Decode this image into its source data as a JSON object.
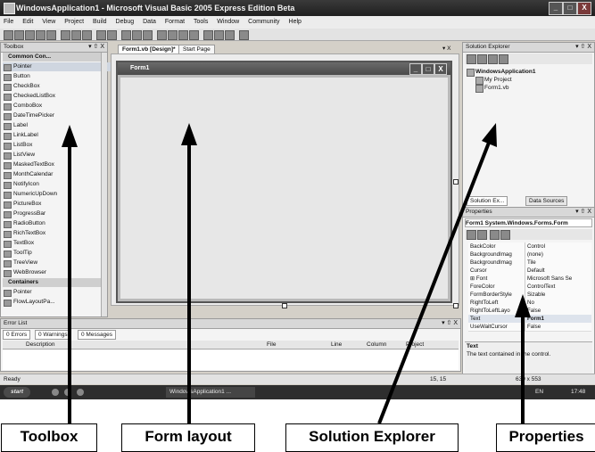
{
  "window": {
    "title": "WindowsApplication1 - Microsoft Visual Basic 2005 Express Edition Beta",
    "minimize_glyph": "_",
    "maximize_glyph": "□",
    "close_glyph": "X"
  },
  "menu": [
    "File",
    "Edit",
    "View",
    "Project",
    "Build",
    "Debug",
    "Data",
    "Format",
    "Tools",
    "Window",
    "Community",
    "Help"
  ],
  "toolbox": {
    "title": "Toolbox",
    "pin": "▾ ⇧ X",
    "sections": {
      "common": "Common Con...",
      "containers": "Containers"
    },
    "items": [
      "Pointer",
      "Button",
      "CheckBox",
      "CheckedListBox",
      "ComboBox",
      "DateTimePicker",
      "Label",
      "LinkLabel",
      "ListBox",
      "ListView",
      "MaskedTextBox",
      "MonthCalendar",
      "NotifyIcon",
      "NumericUpDown",
      "PictureBox",
      "ProgressBar",
      "RadioButton",
      "RichTextBox",
      "TextBox",
      "ToolTip",
      "TreeView",
      "WebBrowser"
    ],
    "container_items": [
      "Pointer",
      "FlowLayoutPa..."
    ]
  },
  "document": {
    "tabs": [
      "Form1.vb [Design]*",
      "Start Page"
    ],
    "close": "▾ X",
    "form_title": "Form1"
  },
  "solution_explorer": {
    "title": "Solution Explorer",
    "pin": "▾ ⇧ X",
    "nodes": [
      "WindowsApplication1",
      "My Project",
      "Form1.vb"
    ],
    "bottom_tabs": [
      "Solution Ex...",
      "Data Sources"
    ]
  },
  "properties": {
    "title": "Properties",
    "pin": "▾ ⇧ X",
    "object": "Form1  System.Windows.Forms.Form",
    "rows": [
      {
        "name": "BackColor",
        "value": "Control"
      },
      {
        "name": "BackgroundImag",
        "value": "(none)"
      },
      {
        "name": "BackgroundImag",
        "value": "Tile"
      },
      {
        "name": "Cursor",
        "value": "Default"
      },
      {
        "name": "⊞ Font",
        "value": "Microsoft Sans Se"
      },
      {
        "name": "ForeColor",
        "value": "ControlText"
      },
      {
        "name": "FormBorderStyle",
        "value": "Sizable"
      },
      {
        "name": "RightToLeft",
        "value": "No"
      },
      {
        "name": "RightToLeftLayo",
        "value": "False"
      },
      {
        "name": "Text",
        "value": "Form1"
      },
      {
        "name": "UseWaitCursor",
        "value": "False"
      }
    ],
    "desc_title": "Text",
    "desc_text": "The text contained in the control."
  },
  "error_list": {
    "title": "Error List",
    "pin": "▾ ⇧ X",
    "filters": [
      "0 Errors",
      "0 Warnings",
      "0 Messages"
    ],
    "columns": [
      "Description",
      "File",
      "Line",
      "Column",
      "Project"
    ]
  },
  "status": {
    "ready": "Ready",
    "position": "15, 15",
    "size": "639 x 553"
  },
  "taskbar": {
    "start": "start",
    "task": "WindowsApplication1 ...",
    "lang": "EN",
    "time": "17:48"
  },
  "callouts": [
    "Toolbox",
    "Form layout",
    "Solution Explorer",
    "Properties"
  ]
}
